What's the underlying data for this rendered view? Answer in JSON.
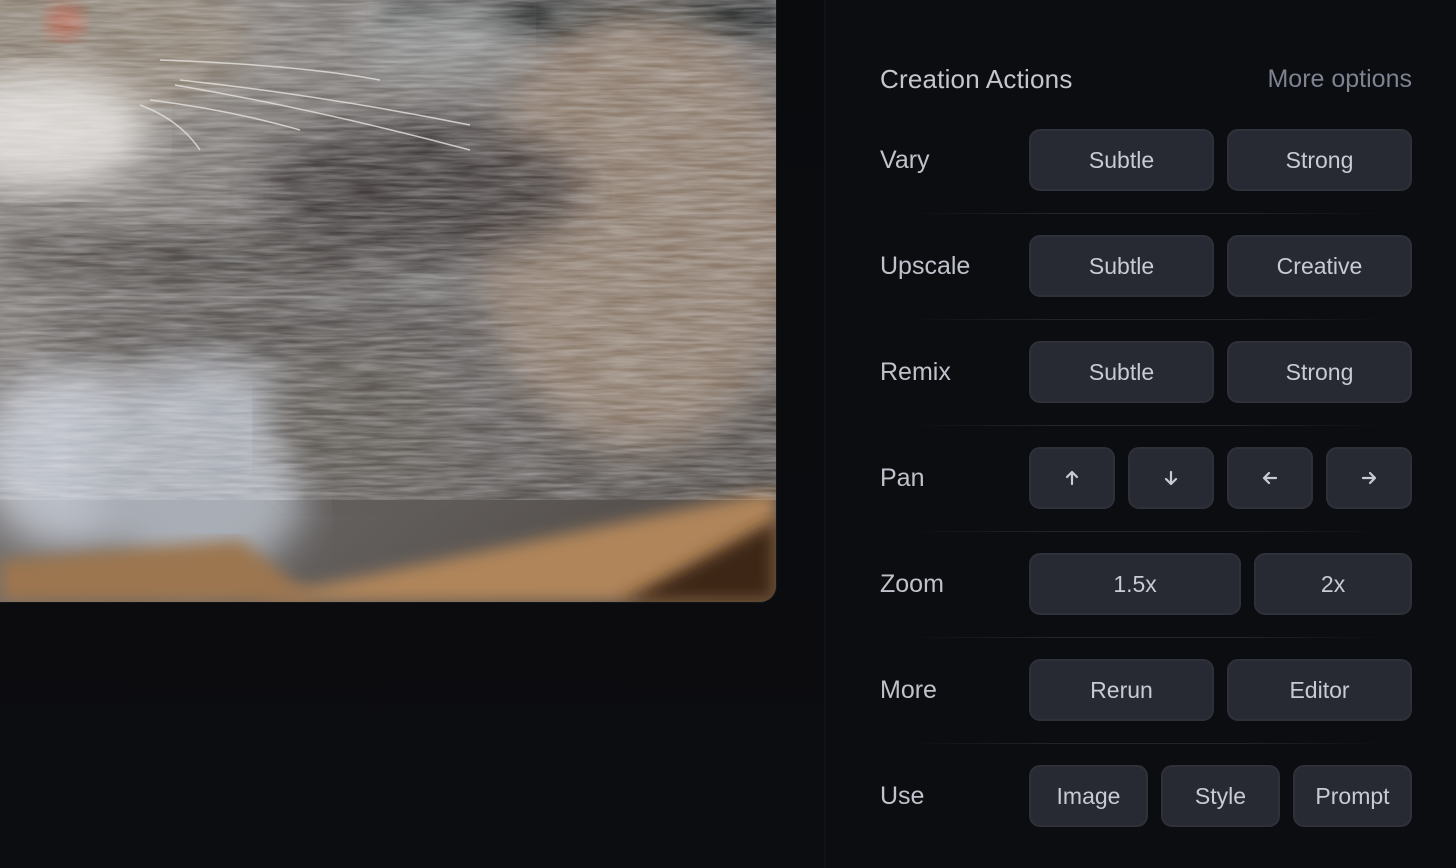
{
  "image": {
    "alt": "Close-up of a sleeping gray tabby cat lying on a wooden surface"
  },
  "panel": {
    "title": "Creation Actions",
    "more_options": "More options",
    "rows": [
      {
        "label": "Vary",
        "buttons": [
          "Subtle",
          "Strong"
        ]
      },
      {
        "label": "Upscale",
        "buttons": [
          "Subtle",
          "Creative"
        ]
      },
      {
        "label": "Remix",
        "buttons": [
          "Subtle",
          "Strong"
        ]
      },
      {
        "label": "Pan",
        "buttons": [
          "arrow-up-icon",
          "arrow-down-icon",
          "arrow-left-icon",
          "arrow-right-icon"
        ]
      },
      {
        "label": "Zoom",
        "buttons": [
          "1.5x",
          "2x"
        ]
      },
      {
        "label": "More",
        "buttons": [
          "Rerun",
          "Editor"
        ]
      },
      {
        "label": "Use",
        "buttons": [
          "Image",
          "Style",
          "Prompt"
        ]
      }
    ]
  },
  "colors": {
    "background": "#0b0c0e",
    "button_bg": "#272a32",
    "button_text": "#c8cbd3",
    "label_text": "#bfc2cb",
    "muted_text": "#7e8291"
  }
}
